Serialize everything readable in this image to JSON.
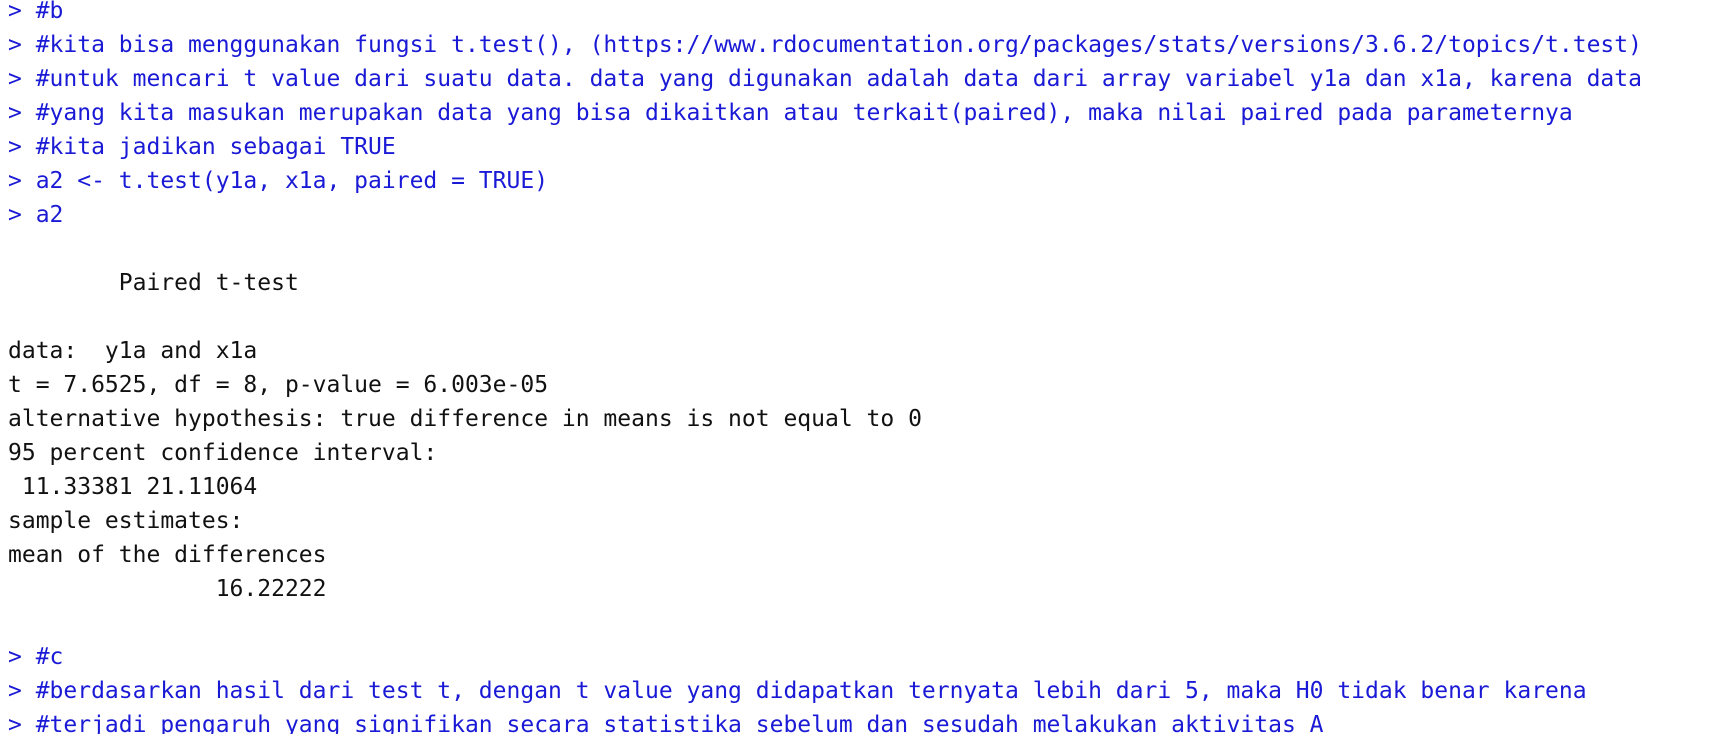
{
  "colors": {
    "input": "#1a1ad6",
    "output": "#111111",
    "background": "#ffffff"
  },
  "console": {
    "lines": [
      {
        "type": "input",
        "text": "> #b"
      },
      {
        "type": "input",
        "text": "> #kita bisa menggunakan fungsi t.test(), (https://www.rdocumentation.org/packages/stats/versions/3.6.2/topics/t.test)"
      },
      {
        "type": "input",
        "text": "> #untuk mencari t value dari suatu data. data yang digunakan adalah data dari array variabel y1a dan x1a, karena data"
      },
      {
        "type": "input",
        "text": "> #yang kita masukan merupakan data yang bisa dikaitkan atau terkait(paired), maka nilai paired pada parameternya"
      },
      {
        "type": "input",
        "text": "> #kita jadikan sebagai TRUE"
      },
      {
        "type": "input",
        "text": "> a2 <- t.test(y1a, x1a, paired = TRUE)"
      },
      {
        "type": "input",
        "text": "> a2"
      },
      {
        "type": "blank",
        "text": ""
      },
      {
        "type": "output",
        "text": "        Paired t-test"
      },
      {
        "type": "blank",
        "text": ""
      },
      {
        "type": "output",
        "text": "data:  y1a and x1a"
      },
      {
        "type": "output",
        "text": "t = 7.6525, df = 8, p-value = 6.003e-05"
      },
      {
        "type": "output",
        "text": "alternative hypothesis: true difference in means is not equal to 0"
      },
      {
        "type": "output",
        "text": "95 percent confidence interval:"
      },
      {
        "type": "output",
        "text": " 11.33381 21.11064"
      },
      {
        "type": "output",
        "text": "sample estimates:"
      },
      {
        "type": "output",
        "text": "mean of the differences"
      },
      {
        "type": "output",
        "text": "               16.22222"
      },
      {
        "type": "blank",
        "text": ""
      },
      {
        "type": "input",
        "text": "> #c"
      },
      {
        "type": "input",
        "text": "> #berdasarkan hasil dari test t, dengan t value yang didapatkan ternyata lebih dari 5, maka H0 tidak benar karena"
      },
      {
        "type": "input",
        "text": "> #terjadi pengaruh yang signifikan secara statistika sebelum dan sesudah melakukan aktivitas A"
      }
    ]
  }
}
